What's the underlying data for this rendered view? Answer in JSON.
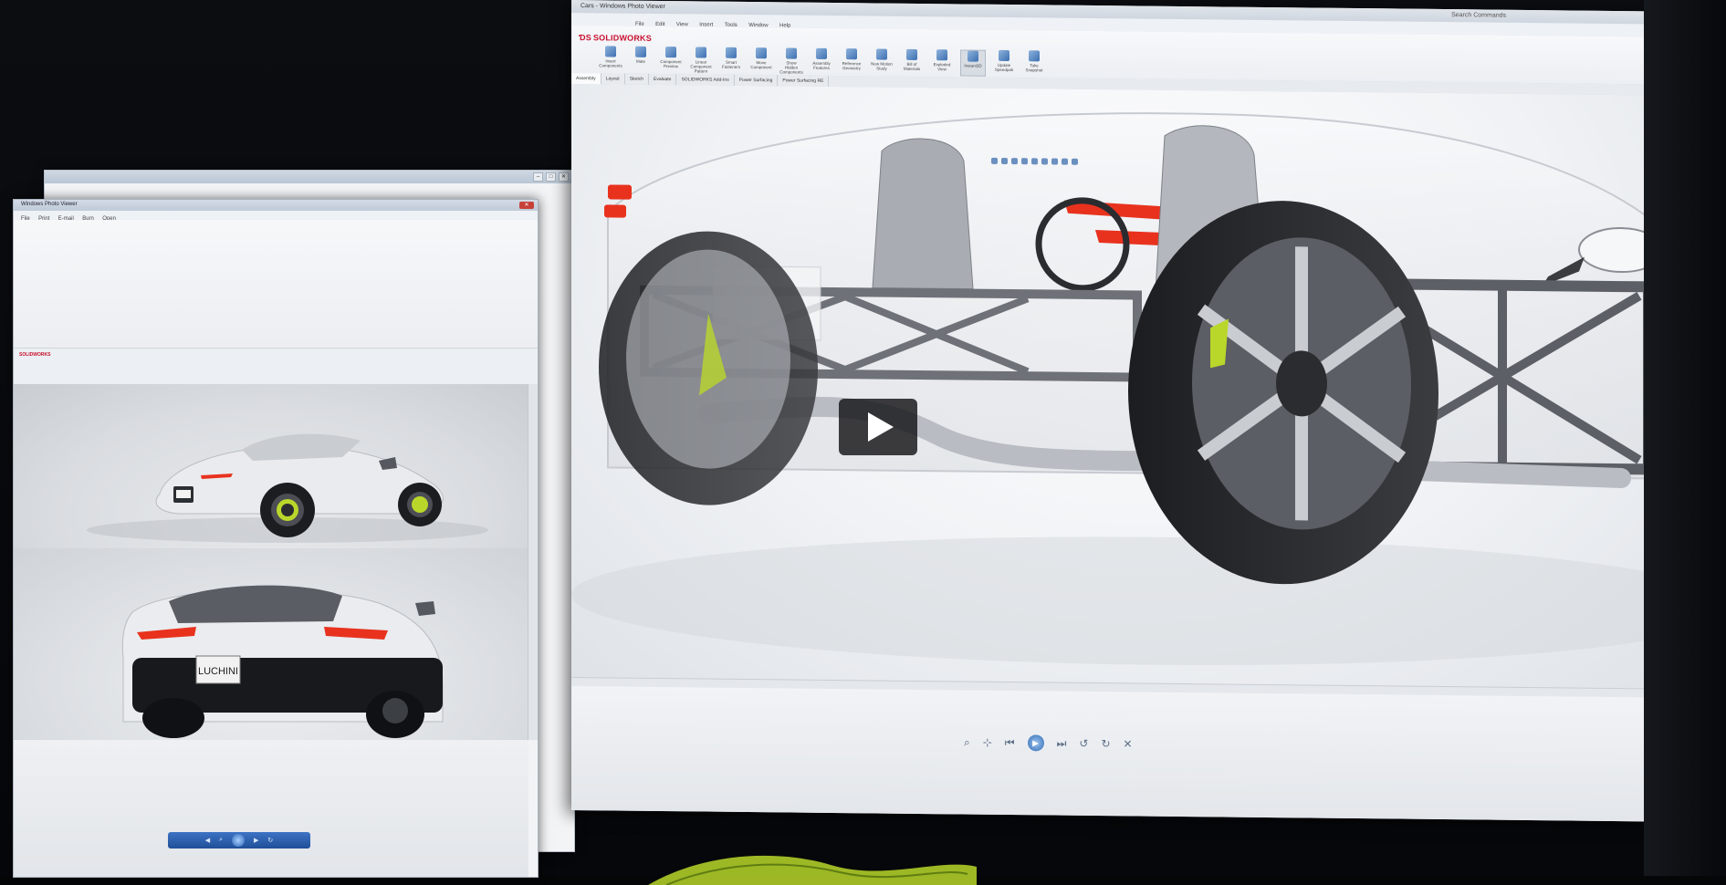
{
  "photo": {
    "description_tags": [
      "monitor-photo",
      "cad-software",
      "car-renders"
    ]
  },
  "solidworks": {
    "app_name": "SOLIDWORKS",
    "title_text": "Cars - Windows Photo Viewer",
    "search_placeholder": "Search Commands",
    "window_buttons": [
      "–",
      "□",
      "✕"
    ],
    "menus": [
      "File",
      "Edit",
      "View",
      "Insert",
      "Tools",
      "Window",
      "Help"
    ],
    "ribbon_tools": [
      {
        "label": "Insert Components",
        "icon": "insert-components-icon"
      },
      {
        "label": "Mate",
        "icon": "mate-icon"
      },
      {
        "label": "Component Preview",
        "icon": "component-preview-icon"
      },
      {
        "label": "Linear Component Pattern",
        "icon": "pattern-icon"
      },
      {
        "label": "Smart Fasteners",
        "icon": "fastener-icon"
      },
      {
        "label": "Move Component",
        "icon": "move-component-icon"
      },
      {
        "label": "Show Hidden Components",
        "icon": "show-hidden-icon"
      },
      {
        "label": "Assembly Features",
        "icon": "assembly-features-icon"
      },
      {
        "label": "Reference Geometry",
        "icon": "reference-geometry-icon"
      },
      {
        "label": "New Motion Study",
        "icon": "motion-study-icon"
      },
      {
        "label": "Bill of Materials",
        "icon": "bom-icon"
      },
      {
        "label": "Exploded View",
        "icon": "exploded-view-icon"
      },
      {
        "label": "Instant3D",
        "icon": "instant3d-icon"
      },
      {
        "label": "Update Speedpak",
        "icon": "speedpak-icon"
      },
      {
        "label": "Take Snapshot",
        "icon": "snapshot-icon"
      }
    ],
    "command_tabs": [
      "Assembly",
      "Layout",
      "Sketch",
      "Evaluate",
      "SOLIDWORKS Add-Ins",
      "Power Surfacing",
      "Power Surfacing RE"
    ],
    "active_tab_index": 0,
    "player_controls": [
      "zoom",
      "fit",
      "previous",
      "slideshow",
      "next",
      "rotate-left",
      "rotate-right",
      "delete"
    ]
  },
  "viewer": {
    "title_text": "Windows Photo Viewer",
    "menus": [
      "File",
      "Print",
      "E-mail",
      "Burn",
      "Open"
    ],
    "car_badge": "LUCHINI"
  },
  "colors": {
    "sw_red": "#c8102e",
    "accent_green": "#b9d72a",
    "highlight_red": "#e8321e",
    "windows_blue": "#2f6bb3"
  }
}
